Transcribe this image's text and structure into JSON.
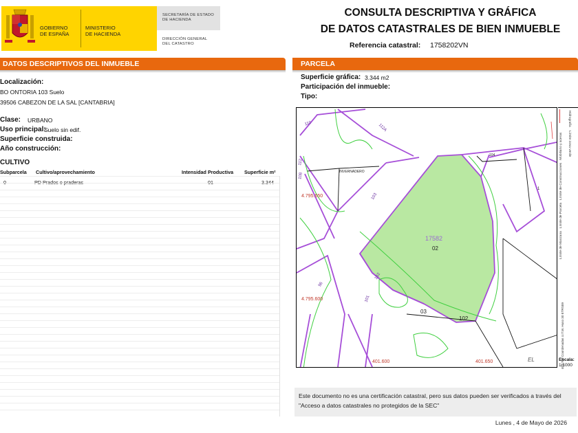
{
  "header": {
    "gobierno": [
      "GOBIERNO",
      "DE ESPAÑA"
    ],
    "ministerio": [
      "MINISTERIO",
      "DE HACIENDA"
    ],
    "secretaria": [
      "SECRETARÍA DE ESTADO",
      "DE HACIENDA"
    ],
    "direccion": [
      "DIRECCIÓN GENERAL",
      "DEL CATASTRO"
    ],
    "title_line1": "CONSULTA DESCRIPTIVA Y GRÁFICA",
    "title_line2": "DE DATOS CATASTRALES DE BIEN INMUEBLE",
    "ref_label": "Referencia catastral:",
    "ref_value": "1758202VN"
  },
  "left": {
    "section_title": "DATOS DESCRIPTIVOS DEL INMUEBLE",
    "localizacion_label": "Localización:",
    "localizacion_line1": "BO ONTORIA 103 Suelo",
    "localizacion_line2": "39506 CABEZON DE LA SAL [CANTABRIA]",
    "clase_label": "Clase:",
    "clase_value": "URBANO",
    "uso_label": "Uso principal:",
    "uso_value": "Suelo sin edif.",
    "superficie_label": "Superficie construida:",
    "ano_label": "Año construcción:",
    "cultivo_title": "CULTIVO",
    "table": {
      "headers": [
        "Subparcela",
        "Cultivo/aprovechamiento",
        "Intensidad Productiva",
        "Superficie m²"
      ],
      "rows": [
        {
          "subparcela": "0",
          "cultivo": "PD Prados o praderas",
          "intensidad": "01",
          "superficie": "3.344"
        }
      ]
    }
  },
  "right": {
    "section_title": "PARCELA",
    "sup_grafica_label": "Superficie gráfica:",
    "sup_grafica_value": "3.344 m2",
    "participacion_label": "Participación del inmueble:",
    "tipo_label": "Tipo:"
  },
  "map": {
    "parcel_ref": "17582",
    "parcel_sub": "02",
    "labels": {
      "invernadero": "INVERNADERO",
      "n03": "03",
      "n102": "102",
      "n104": "104",
      "n96": "96",
      "n103": "103",
      "n102b": "102",
      "n101": "101",
      "n110": "110",
      "n108": "108",
      "n112": "112",
      "n112a": "112A",
      "n1": "1"
    },
    "coords": {
      "y1": "4.795.650",
      "y2": "4.795.600",
      "x1": "401.600",
      "x2": "401.650"
    },
    "scale_letters": "EL",
    "scale_label": "Escala:",
    "scale_value": "1/1000",
    "legend": [
      "Límite de Manzana",
      "Límite de Parcela",
      "Límite de Construcciones",
      "Mobiliario y aceras",
      "Límite zona verde",
      "Hidrografía"
    ],
    "coord_system": "401.700 Coordenadas U.T.M. Huso 30 ETRS89",
    "colors": {
      "parcel_fill": "#b9e8a2",
      "manzana": "#a64ed8",
      "green_line": "#3fcf3f",
      "coord_text": "#c0392b"
    }
  },
  "footer": {
    "note": "Este documento no es una certificación catastral, pero sus datos pueden ser verificados a través del \"Acceso a datos catastrales no protegidos de la SEC\"",
    "date": "Lunes , 4 de Mayo de 2026"
  },
  "colors": {
    "bar": "#e8680e",
    "logo_yellow": "#ffd400"
  }
}
